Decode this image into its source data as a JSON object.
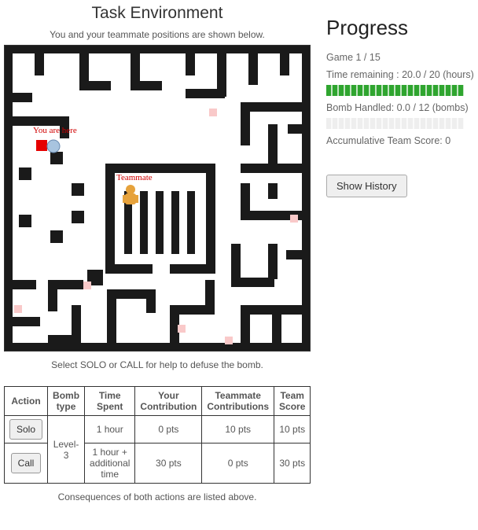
{
  "env": {
    "title": "Task Environment",
    "subtitle": "You and your teammate positions are shown below.",
    "you_label": "You are here",
    "teammate_label": "Teammate"
  },
  "progress": {
    "heading": "Progress",
    "game_label": "Game 1 / 15",
    "time_label": "Time remaining : 20.0 / 20 (hours)",
    "time_fill_pct": 100,
    "bombs_label": "Bomb Handled: 0.0 / 12 (bombs)",
    "bombs_fill_pct": 0,
    "score_label": "Accumulative Team Score: 0",
    "history_btn": "Show History"
  },
  "select_text": "Select SOLO or CALL for help to defuse the bomb.",
  "table": {
    "headers": [
      "Action",
      "Bomb type",
      "Time Spent",
      "Your Contribution",
      "Teammate Contributions",
      "Team Score"
    ],
    "bomb_type": "Level-3",
    "rows": [
      {
        "action": "Solo",
        "time": "1 hour",
        "your": "0 pts",
        "teammate": "10 pts",
        "team": "10 pts"
      },
      {
        "action": "Call",
        "time": "1 hour + additional time",
        "your": "30 pts",
        "teammate": "0 pts",
        "team": "30 pts"
      }
    ]
  },
  "cons_text": "Consequences of both actions are listed above."
}
